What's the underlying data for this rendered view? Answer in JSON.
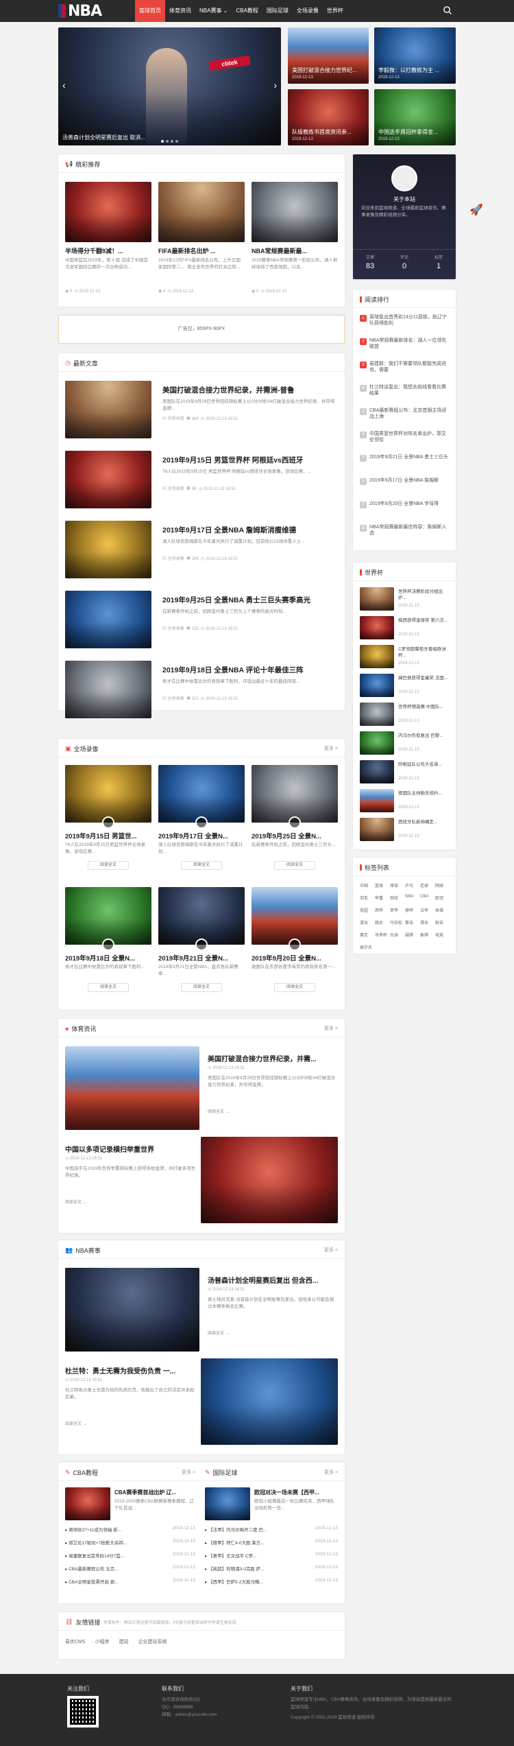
{
  "nav": {
    "logo": "NBA",
    "items": [
      "篮球首页",
      "体育资讯",
      "NBA赛事 ⌄",
      "CBA教程",
      "国际足球",
      "全场录像",
      "世界杯"
    ]
  },
  "slider": {
    "caption": "汤普森计划全明星赛后复出 取消..."
  },
  "top_thumbs": [
    {
      "title": "美国打破混合接力世界纪...",
      "date": "2019-12-13"
    },
    {
      "title": "李毅微：以打教练为主 ...",
      "date": "2019-12-13"
    },
    {
      "title": "队级教练书首席资讯参...",
      "date": "2019-12-13"
    },
    {
      "title": "中国选手周冠杯拿得金...",
      "date": "2019-12-13"
    }
  ],
  "featured": {
    "title": "精彩推荐",
    "items": [
      {
        "title": "半场得分千翻9减！...",
        "text": "中国男篮在2019年，第 9 届 完成了中国首次进军国际比赛的一次出奇成功...",
        "views": "0",
        "date": "2019-12-13"
      },
      {
        "title": "FIFA最新排名出炉 ...",
        "text": "2019年12月FIFA最新排名公布，上升位国家国际第二、、再全发布世界的打关比较...",
        "views": "0",
        "date": "2019-12-13"
      },
      {
        "title": "NBA常规赛最新最...",
        "text": "2019赛季NBA常规赛第一阶段公布，湖人继续保持了西部领跑，以及...",
        "views": "0",
        "date": "2019-12-13"
      }
    ]
  },
  "ad": {
    "text": "广告位，855PX-90PX"
  },
  "latest": {
    "title": "最新文章",
    "items": [
      {
        "title": "美国打破混合接力世界纪录，并需洲-普鲁",
        "text": "美国队在2019年9月29日世界田径锦标赛上以3分09秒34打破混合接力世界纪录，并夺得金牌...",
        "cat": "世界体育",
        "views": "366",
        "date": "2019-12-13 16:51"
      },
      {
        "title": "2019年9月15日 男篮世界杯 阿根廷vs西班牙",
        "text": "76人队2019年9月15日 男篮世界杯 阿根廷vs西班牙全场录像，该场比赛，...",
        "cat": "全场录像",
        "views": "68",
        "date": "2019-12-13 16:51"
      },
      {
        "title": "2019年9月17日 全景NBA 詹姆斯消瘦维德",
        "text": "湖人队球员詹姆斯在今年夏天执行了减重计划，目前他以23场体重人士...",
        "cat": "全场录像",
        "views": "284",
        "date": "2019-12-13 16:51"
      },
      {
        "title": "2019年9月25日 全景NBA 勇士三巨头赛季高光",
        "text": "在新赛季开始之前，回顾金州勇士三巨头上个赛季的高光时刻...",
        "cat": "全场录像",
        "views": "228",
        "date": "2019-12-13 16:51"
      },
      {
        "title": "2019年9月18日 全景NBA 评论十年最佳三阵",
        "text": "奇才在比赛中依靠比尔的表现拿下胜利，评选出最近十年的最佳阵容...",
        "cat": "全场录像",
        "views": "321",
        "date": "2019-12-13 16:51"
      }
    ]
  },
  "videos": {
    "title": "全场录像",
    "more": "更多 >",
    "btn": "阅读全文",
    "items": [
      {
        "title": "2019年9月15日 男篮世...",
        "text": "76人队2019年9月15日男篮世界杯全场录像，该场比赛..."
      },
      {
        "title": "2019年9月17日 全景N...",
        "text": "湖人队球员詹姆斯在今年夏天执行了减重计划..."
      },
      {
        "title": "2019年9月25日 全景N...",
        "text": "在新赛季开始之前，回顾金州勇士三巨头..."
      },
      {
        "title": "2019年9月18日 全景N...",
        "text": "奇才在比赛中依靠比尔的表现拿下胜利..."
      },
      {
        "title": "2019年9月21日 全景N...",
        "text": "2019年9月21日全景NBA，盘点各队新赛季..."
      },
      {
        "title": "2019年9月20日 全景N...",
        "text": "雄鹿队在东部依靠字母哥的表现排名第一..."
      }
    ]
  },
  "sports_news": {
    "title": "体育资讯",
    "more": "更多 >",
    "read": "阅读全文 →",
    "items": [
      {
        "title": "美国打破混合接力世界纪录，并需...",
        "text": "美国队在2019年9月29日世界田径锦标赛上以3分09秒34打破混合接力世界纪录，并夺得金牌。",
        "date": "2019-12-13 16:51"
      },
      {
        "title": "中国以多项记录横扫举重世界",
        "text": "中国选手在2019年世界举重锦标赛上获得多枚金牌，并打破多项世界纪录。",
        "date": "2019-12-13 16:51"
      }
    ]
  },
  "nba_events": {
    "title": "NBA赛事",
    "more": "更多 >",
    "read": "阅读全文 →",
    "items": [
      {
        "title": "汤普森计划全明星赛后复出 但含西...",
        "text": "勇士球员克莱·汤普森计划在全明星赛后复出，但他承认可能会错过本赛季剩余比赛。",
        "date": "2019-12-13 16:51"
      },
      {
        "title": "杜兰特：勇士无需为我受伤负责 一...",
        "text": "杜兰特表示勇士无需为他的伤病负责，他做出了自己的决定并承担后果。",
        "date": "2019-12-13 16:51"
      }
    ]
  },
  "cba": {
    "title": "CBA教程",
    "more": "更多 >",
    "lead_title": "CBA赛季赛首战出炉 辽...",
    "lead_text": "2019-2020赛季CBA联赛新赛季赛程，辽宁队首战...",
    "list": [
      {
        "t": "周琦砍27+11成为领袖 新...",
        "d": "2019-12-13"
      },
      {
        "t": "郭艾伦17助攻+7抢断大杀四...",
        "d": "2019-12-13"
      },
      {
        "t": "易建联复出首秀砍14分7篮...",
        "d": "2019-12-13"
      },
      {
        "t": "CBA最新赛程公布 北京...",
        "d": "2019-12-13"
      },
      {
        "t": "CBA全明星投票开启 郭...",
        "d": "2019-12-13"
      }
    ]
  },
  "soccer": {
    "title": "国际足球",
    "more": "更多 >",
    "lead_title": "欧冠对决一场未赛【西甲...",
    "lead_text": "欧冠小组赛最后一轮比赛结束，西甲球队出线形势一览...",
    "list": [
      {
        "t": "【法甲】内马尔梅开二度 巴...",
        "d": "2019-12-13"
      },
      {
        "t": "【德甲】拜仁4-0大胜 莱万...",
        "d": "2019-12-13"
      },
      {
        "t": "【意甲】尤文战平 C罗...",
        "d": "2019-12-13"
      },
      {
        "t": "【英超】利物浦3-0完胜 萨...",
        "d": "2019-12-13"
      },
      {
        "t": "【西甲】巴萨5-2大胜马略...",
        "d": "2019-12-13"
      }
    ]
  },
  "links": {
    "title": "友情链接",
    "note": "申请条件：网站正常运营不卸载链接，PR值与权重相当即可申请互换友链",
    "items": [
      "易优CMS",
      "小程序",
      "建站",
      "企业建站系统"
    ]
  },
  "about": {
    "title": "关于本站",
    "text": "欢迎来到篮球频道，全球最新篮球资讯、赛事录像及精彩视频分享。",
    "stats": [
      {
        "label": "文章",
        "value": "83"
      },
      {
        "label": "评论",
        "value": "0"
      },
      {
        "label": "标签",
        "value": "1"
      }
    ]
  },
  "ranking": {
    "title": "阅读排行",
    "items": [
      "周琦复出首秀砍14分11篮板，助辽宁队获得胜利",
      "NBA常规赛最新排名：湖人一位领先联盟",
      "易建联：我们不需要领队都能完成进攻，需要",
      "杜兰特谈复出：我想去前线看看比赛结果",
      "CBA最新赛程公布：北京首钢主场迎战上海",
      "中国男篮世界杯对阵名单出炉，郭艾伦领衔",
      "2019年9月21日 全景NBA 勇士三巨头",
      "2019年9月17日 全景NBA 詹姆斯",
      "2019年9月20日 全景NBA 字母哥",
      "NBA常规赛最新最佳阵容：詹姆斯入选"
    ]
  },
  "world_cup": {
    "title": "世界杯",
    "items": [
      {
        "t": "世界杯决赛阶段分组出炉...",
        "d": "2019-12-13"
      },
      {
        "t": "梅西获得金球奖 第六次...",
        "d": "2019-12-13"
      },
      {
        "t": "C罗领跑葡萄牙晋级欧洲杯...",
        "d": "2019-12-13"
      },
      {
        "t": "姆巴佩获得金童奖 法国...",
        "d": "2019-12-13"
      },
      {
        "t": "世界杯预选赛 中国队...",
        "d": "2019-12-13"
      },
      {
        "t": "内马尔伤愈复出 巴黎...",
        "d": "2019-12-13"
      },
      {
        "t": "阿根廷队公布大名单...",
        "d": "2019-12-13"
      },
      {
        "t": "德国队主帅勒夫续约...",
        "d": "2019-12-13"
      },
      {
        "t": "西班牙队新帅确定...",
        "d": "2019-12-13"
      }
    ]
  },
  "tags": {
    "title": "标签列表",
    "items": [
      "中国",
      "篮球",
      "排球",
      "乒乓",
      "足球",
      "网球",
      "羽毛",
      "举重",
      "田径",
      "NBA",
      "CBA",
      "欧冠",
      "英超",
      "西甲",
      "意甲",
      "德甲",
      "法甲",
      "体操",
      "游泳",
      "跳水",
      "马拉松",
      "拳击",
      "滑冰",
      "射击",
      "赛车",
      "世界杯",
      "台球",
      "围棋",
      "象棋",
      "电竞",
      "高尔夫"
    ]
  },
  "footer": {
    "col1_title": "关注我们",
    "col2_title": "联系我们",
    "col2_lines": [
      "合作请咨询商务QQ",
      "QQ：88888888",
      "邮箱：admin@yoursite.com"
    ],
    "col3_title": "关于我们",
    "col3_lines": [
      "篮球频道专注NBA、CBA赛事资讯、全场录像及精彩视频，为球迷提供最新最全的篮球内容。"
    ],
    "copyright": "Copyright © 2002-2019 篮球频道 版权所有"
  }
}
